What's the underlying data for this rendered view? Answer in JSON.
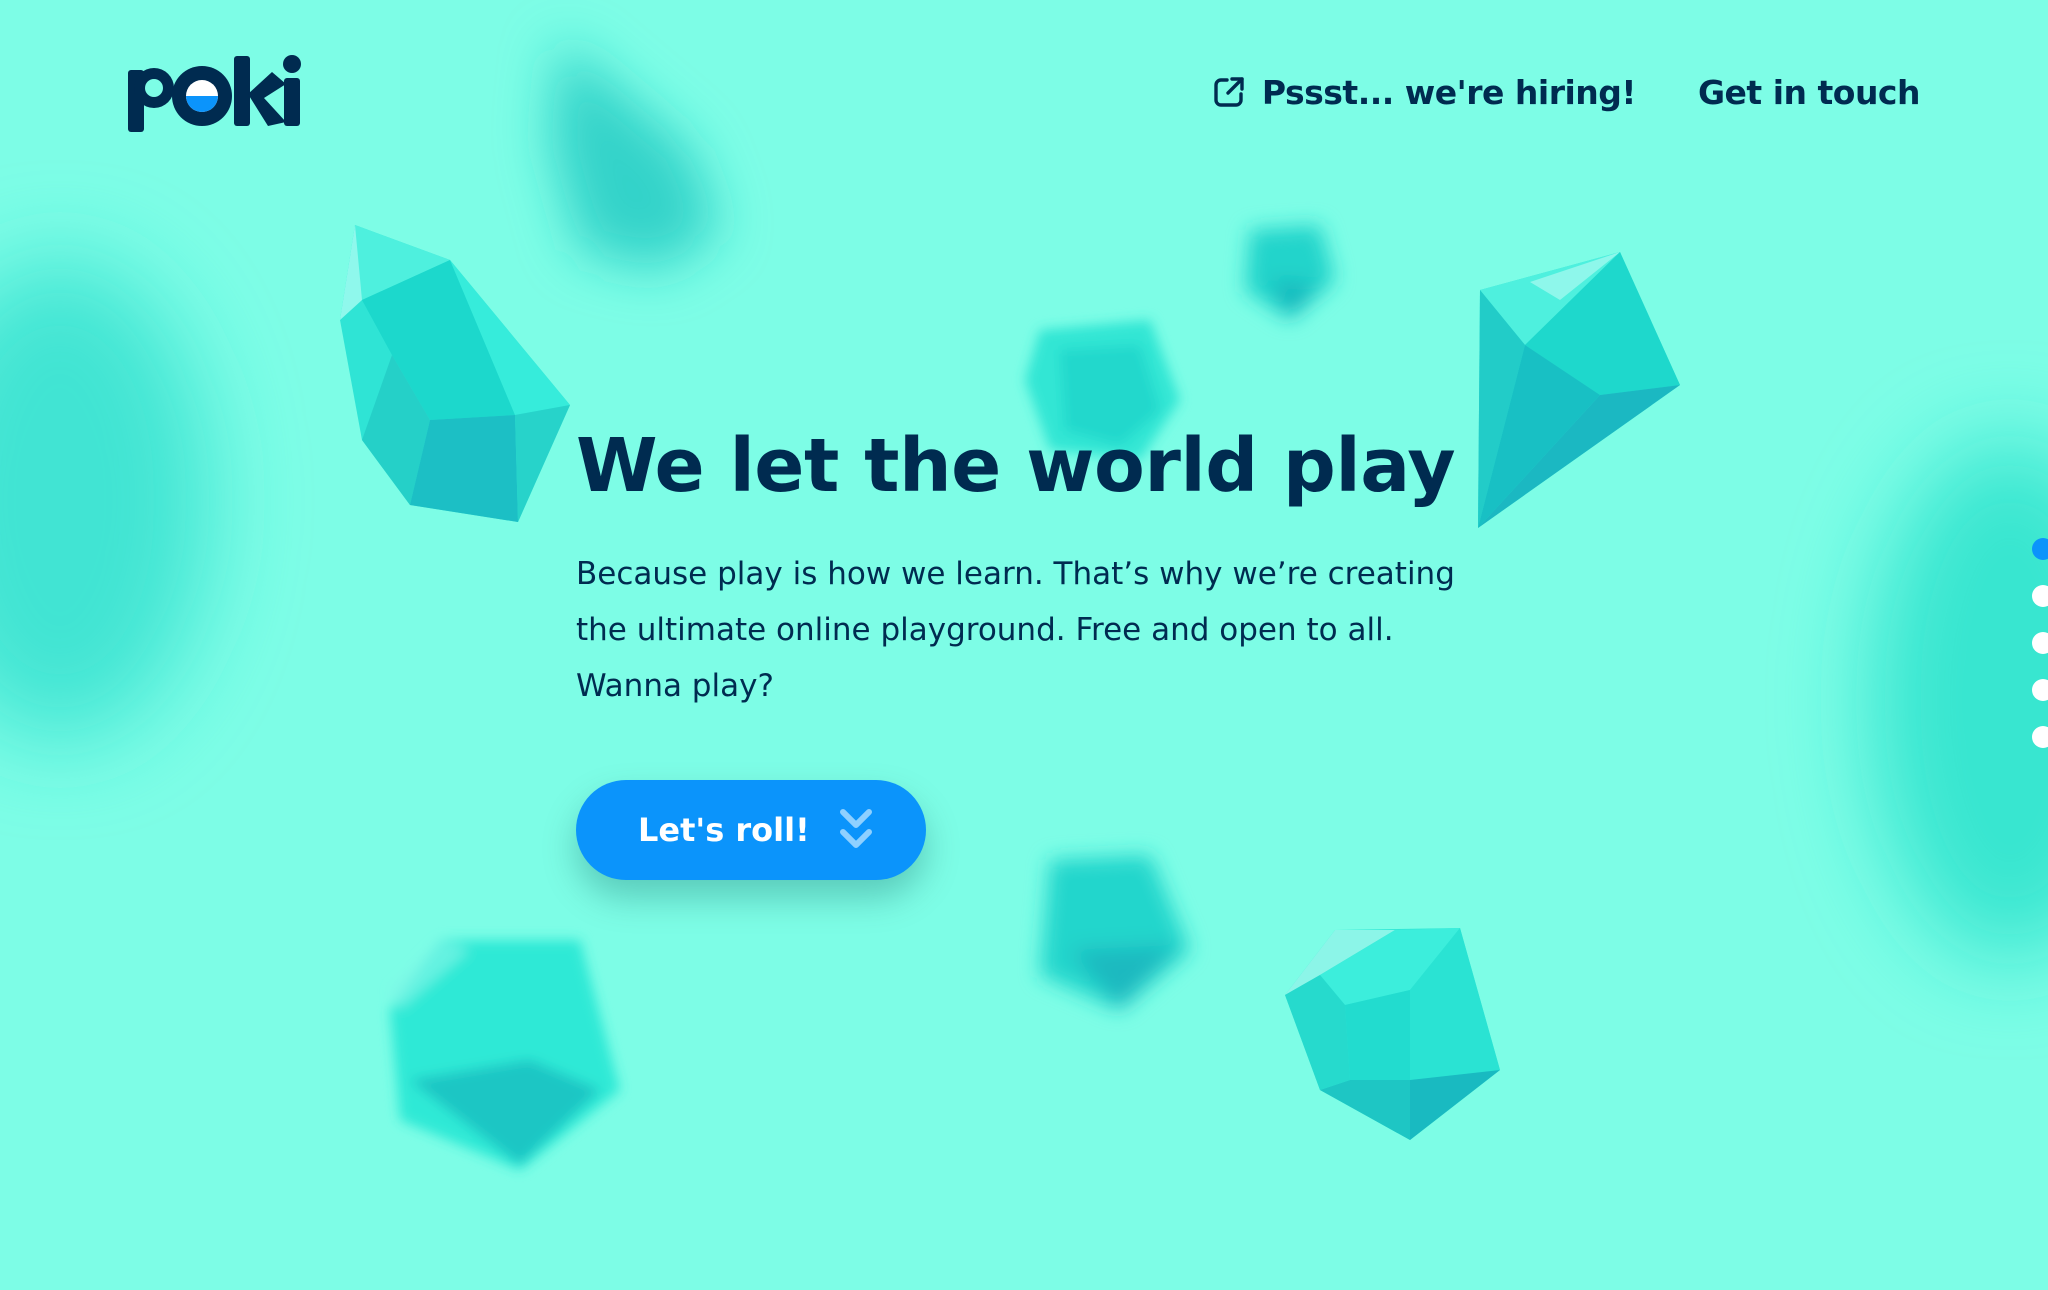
{
  "brand": {
    "logo_text": "poki",
    "colors": {
      "background": "#7dfde6",
      "navy": "#002b50",
      "blue": "#0b94fb"
    }
  },
  "header": {
    "nav": [
      {
        "label": "Pssst... we're hiring!",
        "icon": "external-link-icon"
      },
      {
        "label": "Get in touch"
      }
    ]
  },
  "hero": {
    "title": "We let the world play",
    "text": "Because play is how we learn. That’s why we’re creating the ultimate online playground. Free and open to all. Wanna play?",
    "cta_label": "Let's roll!",
    "cta_icon": "double-chevron-down-icon"
  },
  "section_dots": {
    "count": 5,
    "active_index": 0
  }
}
